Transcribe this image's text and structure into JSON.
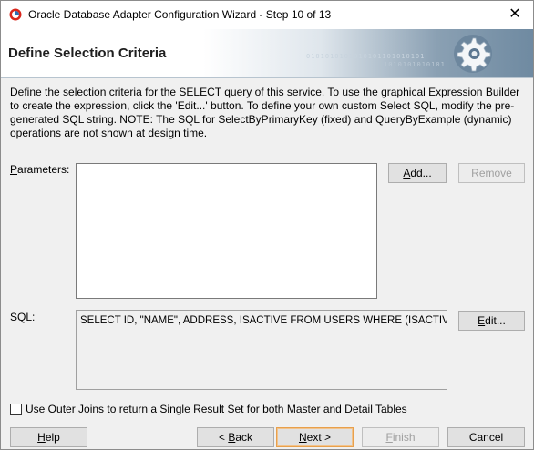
{
  "window": {
    "title": "Oracle Database Adapter Configuration Wizard - Step 10 of 13",
    "close_glyph": "✕"
  },
  "banner": {
    "title": "Define Selection Criteria",
    "binary_line1": "0101010101010101101010101",
    "binary_line2": "1010101010101"
  },
  "description": "Define the selection criteria for the SELECT query of this service.  To use the graphical Expression Builder to create the expression, click the 'Edit...' button.  To define your own custom Select SQL, modify the pre-generated SQL string.  NOTE: The SQL for SelectByPrimaryKey (fixed) and QueryByExample (dynamic) operations are not shown at design time.",
  "parameters": {
    "label_mnemonic": "P",
    "label_rest": "arameters:",
    "items": [],
    "add_mnemonic": "A",
    "add_rest": "dd...",
    "remove_label": "Remove"
  },
  "sql": {
    "label_mnemonic": "S",
    "label_rest": "QL:",
    "query": "SELECT ID, \"NAME\", ADDRESS, ISACTIVE FROM USERS WHERE (ISACTIVE = 'L')",
    "edit_mnemonic": "E",
    "edit_rest": "dit..."
  },
  "outer_joins": {
    "checked": false,
    "label_mnemonic": "U",
    "label_rest": "se Outer Joins to return a Single Result Set for both Master and Detail Tables"
  },
  "footer": {
    "help_mnemonic": "H",
    "help_rest": "elp",
    "back_prefix": "< ",
    "back_mnemonic": "B",
    "back_rest": "ack",
    "next_mnemonic": "N",
    "next_rest": "ext >",
    "finish_mnemonic": "F",
    "finish_rest": "inish",
    "cancel_label": "Cancel"
  },
  "icons": {
    "app": "oracle-app-icon",
    "banner": "gear-icon"
  },
  "colors": {
    "default_button_border": "#e8a04c",
    "disabled_text": "#a0a0a0",
    "app_icon_red": "#d9261c"
  }
}
